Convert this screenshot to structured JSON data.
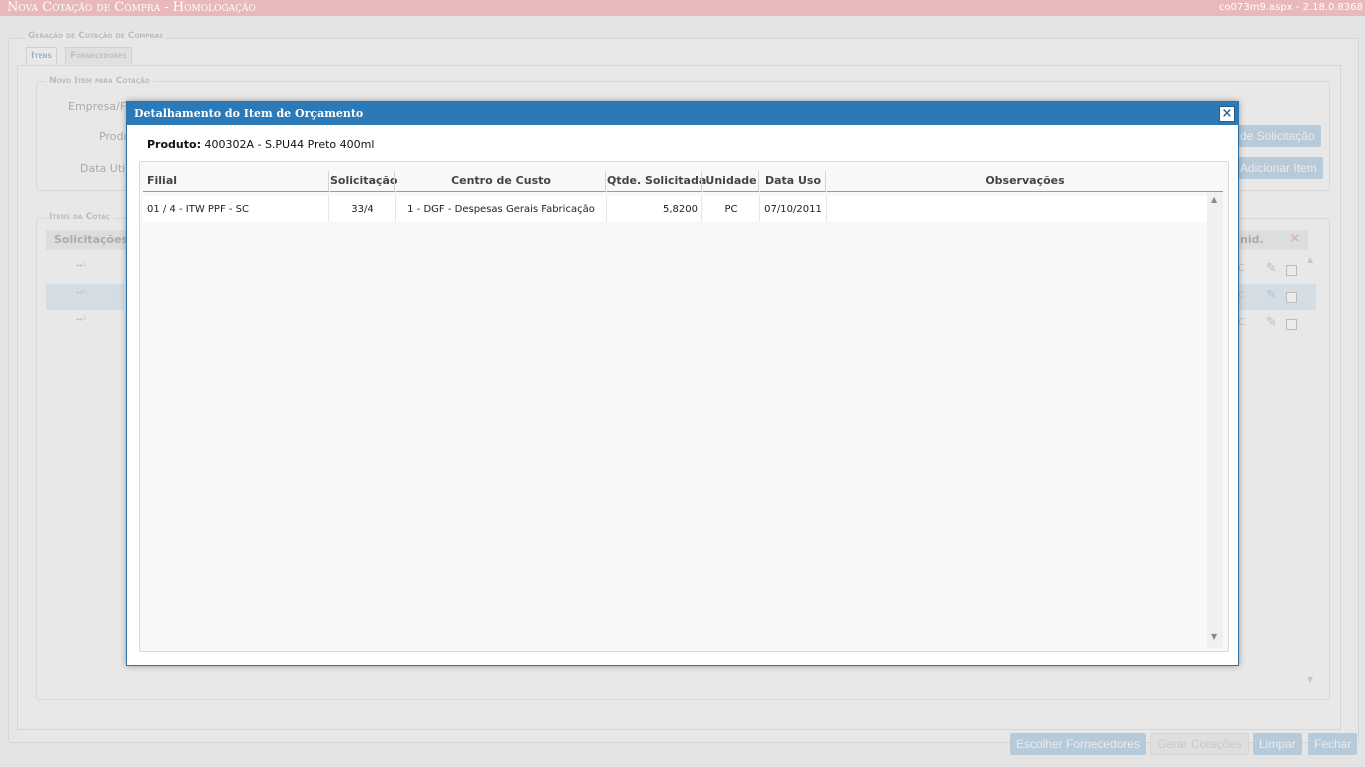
{
  "app": {
    "title": "Nova Cotação de Compra  - Homologação",
    "version": "co073m9.aspx - 2.18.0.8368"
  },
  "background": {
    "fieldset_title": "Geração de Cotação de Compras",
    "tabs": [
      "Itens",
      "Fornecedores"
    ],
    "novo_item_title": "Novo Item para Cotação",
    "labels": {
      "empresa": "Empresa/Fil",
      "produto": "Produ",
      "data_utilizacao": "Data Utili"
    },
    "buttons": {
      "solicitacao": "de Solicitação",
      "adicionar_item": "Adicionar Item"
    },
    "itens_title": "Itens da Cotaç",
    "grid": {
      "col_solicitacoes": "Solicitações",
      "col_unid": "nid.",
      "rows": [
        {
          "icon_text": "↔¹",
          "unit": "C"
        },
        {
          "icon_text": "↔¹",
          "unit": "C"
        },
        {
          "icon_text": "↔¹",
          "unit": "C"
        }
      ]
    }
  },
  "footer": {
    "escolher": "Escolher Fornecedores",
    "gerar": "Gerar Cotações",
    "limpar": "Limpar",
    "fechar": "Fechar"
  },
  "modal": {
    "title": "Detalhamento do Item de Orçamento",
    "close_glyph": "×",
    "produto_label": "Produto:",
    "produto_value": "400302A - S.PU44 Preto 400ml",
    "columns": [
      "Filial",
      "Solicitação",
      "Centro de Custo",
      "Qtde. Solicitada",
      "Unidade",
      "Data Uso",
      "Observações"
    ],
    "rows": [
      {
        "filial": "01 / 4 - ITW PPF - SC",
        "solicitacao": "33/4",
        "centro_custo": "1 - DGF - Despesas Gerais Fabricação",
        "qtde": "5,8200",
        "unidade": "PC",
        "data_uso": "07/10/2011",
        "observacoes": ""
      }
    ]
  }
}
